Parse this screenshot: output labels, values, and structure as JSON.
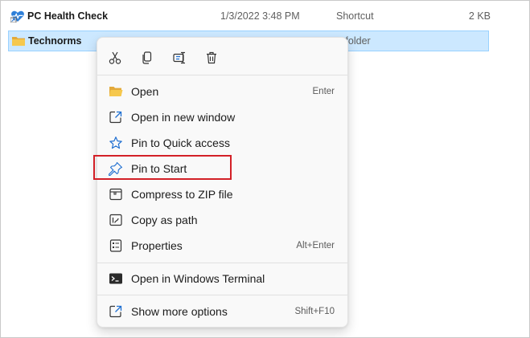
{
  "files": [
    {
      "name": "PC Health Check",
      "date": "1/3/2022 3:48 PM",
      "type": "Shortcut",
      "size": "2 KB",
      "icon": "heart-shortcut-icon"
    },
    {
      "name": "Technorms",
      "type_partial": "e folder",
      "icon": "folder-icon",
      "selected": true
    }
  ],
  "context_menu": {
    "quick_actions": [
      {
        "name": "cut",
        "icon": "scissors-icon"
      },
      {
        "name": "copy",
        "icon": "copy-icon"
      },
      {
        "name": "rename",
        "icon": "rename-icon"
      },
      {
        "name": "delete",
        "icon": "trash-icon"
      }
    ],
    "items": [
      {
        "label": "Open",
        "shortcut": "Enter",
        "icon": "folder-open-icon"
      },
      {
        "label": "Open in new window",
        "shortcut": "",
        "icon": "new-window-icon"
      },
      {
        "label": "Pin to Quick access",
        "shortcut": "",
        "icon": "star-icon"
      },
      {
        "label": "Pin to Start",
        "shortcut": "",
        "icon": "pin-icon"
      },
      {
        "label": "Compress to ZIP file",
        "shortcut": "",
        "icon": "zip-icon"
      },
      {
        "label": "Copy as path",
        "shortcut": "",
        "icon": "copy-path-icon"
      },
      {
        "label": "Properties",
        "shortcut": "Alt+Enter",
        "icon": "properties-icon"
      },
      {
        "label": "Open in Windows Terminal",
        "shortcut": "",
        "icon": "terminal-icon"
      },
      {
        "label": "Show more options",
        "shortcut": "Shift+F10",
        "icon": "more-options-icon"
      }
    ]
  },
  "colors": {
    "selection_bg": "#cce8ff",
    "selection_border": "#99d1ff",
    "highlight_box": "#d32027",
    "menu_bg": "#f9f9f9",
    "icon_blue": "#1f6fd1"
  }
}
